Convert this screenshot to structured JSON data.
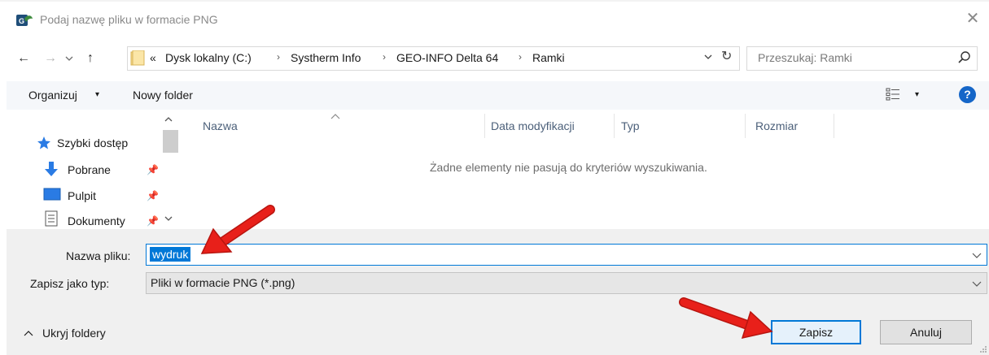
{
  "window": {
    "title": "Podaj nazwę pliku w formacie PNG",
    "close_glyph": "✕"
  },
  "nav": {
    "back_glyph": "←",
    "forward_glyph": "→",
    "dropdown_glyph": "⌄",
    "up_glyph": "↑",
    "breadcrumb_overflow": "«",
    "breadcrumbs": [
      "Dysk lokalny (C:)",
      "Systherm Info",
      "GEO-INFO Delta 64",
      "Ramki"
    ],
    "sep_glyph": "›",
    "refresh_glyph": "↻",
    "search_placeholder": "Przeszukaj: Ramki"
  },
  "toolbar": {
    "organize_label": "Organizuj",
    "new_folder_label": "Nowy folder",
    "help_glyph": "?",
    "caret_glyph": "▾"
  },
  "sidebar": {
    "items": [
      {
        "label": "Szybki dostęp",
        "icon": "star-icon"
      },
      {
        "label": "Pobrane",
        "icon": "download-icon",
        "pinned": true
      },
      {
        "label": "Pulpit",
        "icon": "desktop-icon",
        "pinned": true
      },
      {
        "label": "Dokumenty",
        "icon": "documents-icon",
        "pinned": true
      }
    ],
    "pin_glyph": "📌"
  },
  "filelist": {
    "columns": [
      "Nazwa",
      "Data modyfikacji",
      "Typ",
      "Rozmiar"
    ],
    "empty_message": "Żadne elementy nie pasują do kryteriów wyszukiwania."
  },
  "form": {
    "filename_label": "Nazwa pliku:",
    "filename_value": "wydruk",
    "filetype_label": "Zapisz jako typ:",
    "filetype_value": "Pliki w formacie PNG (*.png)"
  },
  "footer": {
    "hide_folders_label": "Ukryj foldery",
    "save_label": "Zapisz",
    "cancel_label": "Anuluj"
  },
  "colors": {
    "accent": "#0078d7",
    "annotation_arrow": "#e8201a",
    "help": "#1566c8"
  }
}
